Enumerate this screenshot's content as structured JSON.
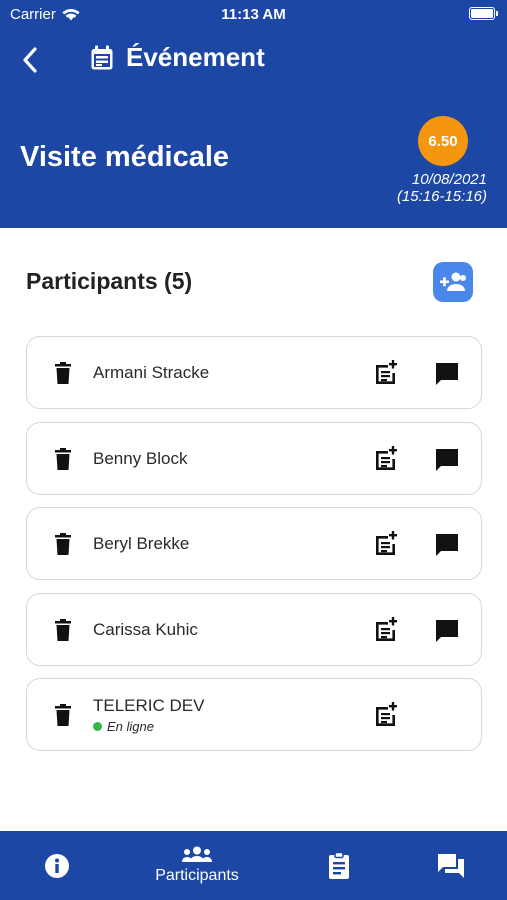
{
  "status_bar": {
    "carrier": "Carrier",
    "time": "11:13 AM"
  },
  "header": {
    "title": "Événement",
    "event_name": "Visite médicale",
    "score": "6.50",
    "date": "10/08/2021",
    "time_range": "(15:16-15:16)"
  },
  "participants": {
    "title": "Participants (5)",
    "items": [
      {
        "name": "Armani Stracke",
        "status": null,
        "has_chat": true
      },
      {
        "name": "Benny Block",
        "status": null,
        "has_chat": true
      },
      {
        "name": "Beryl Brekke",
        "status": null,
        "has_chat": true
      },
      {
        "name": "Carissa Kuhic",
        "status": null,
        "has_chat": true
      },
      {
        "name": "TELERIC DEV",
        "status": "En ligne",
        "has_chat": false
      }
    ]
  },
  "tabbar": {
    "active": "Participants",
    "tabs": [
      {
        "icon": "info-icon",
        "label": ""
      },
      {
        "icon": "group-icon",
        "label": "Participants"
      },
      {
        "icon": "clipboard-icon",
        "label": ""
      },
      {
        "icon": "chat-icon",
        "label": ""
      }
    ]
  },
  "colors": {
    "primary": "#1c47a5",
    "score_badge": "#f5960f",
    "online": "#33b54a",
    "add_button": "#4a87ea"
  }
}
